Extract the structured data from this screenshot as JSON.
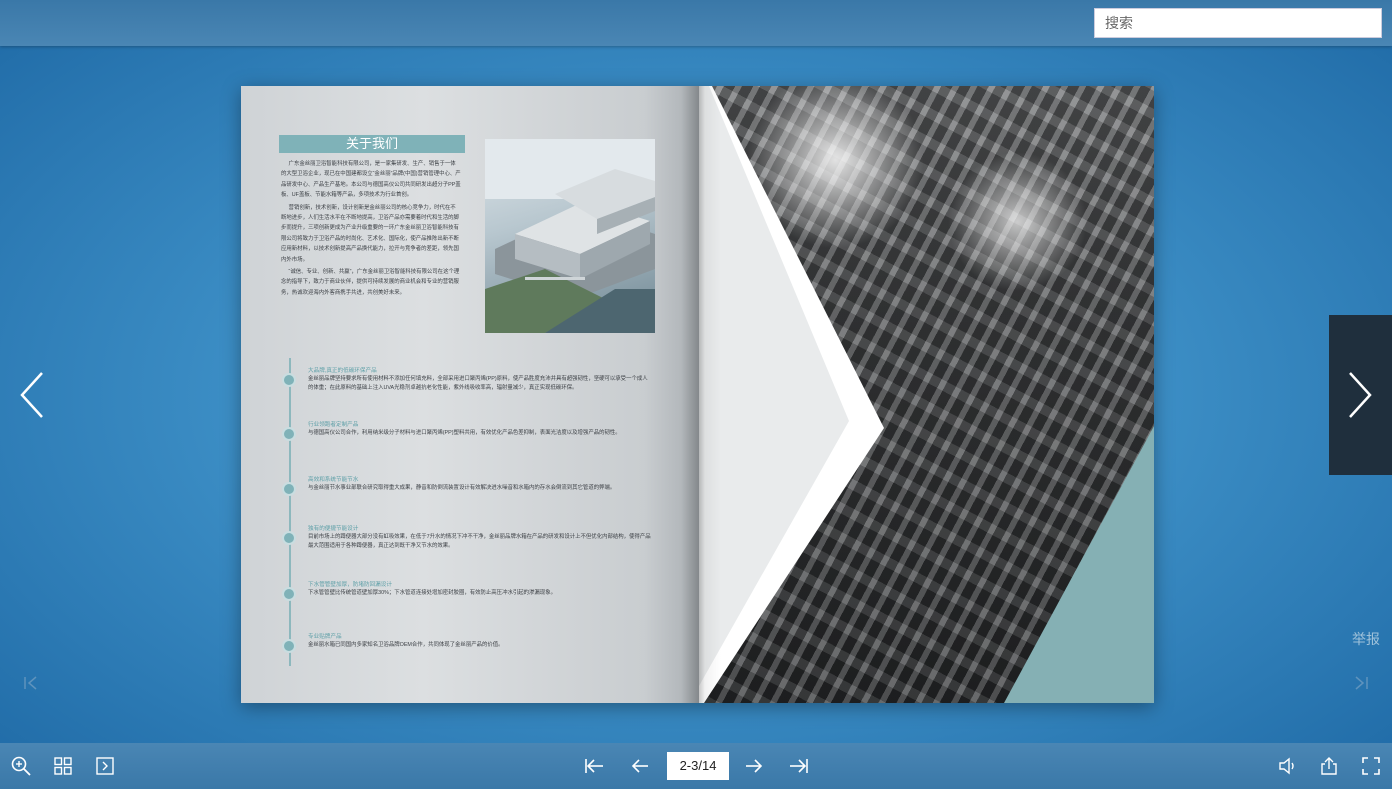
{
  "search": {
    "placeholder": "搜索"
  },
  "book": {
    "left_page": {
      "about": {
        "title": "关于我们",
        "paragraphs": [
          "广东金丝丽卫浴智能科技有限公司，是一家集研发、生产、销售于一体的大型卫浴企业，现已在中国建都设立“金丝丽”品牌(中国)营销管理中心、产品研发中心、产品生产基地。本公司与德国高仪公司共同研发出超分子PP盖板、UF盖板、节能水箱等产品，多项技术为行业首创。",
          "营销创新，技术创新，设计创新是金丝丽公司的核心竞争力，时代在不断地进步，人们生活水平在不断地提高，卫浴产品亦需要着时代和生活的脚步而提升，三项创新更成为产业升级重要的一环广东金丝丽卫浴智能科技有限公司将致力于卫浴产品的时尚化、艺术化、国际化，使产品推陈出新不断应用新材料，以技术创新提高产品换代能力，拉开与竞争者的差距，领先国内外市场。",
          "“诚信、专业、创新、共赢”，广东金丝丽卫浴智能科技有限公司在这个理念的指导下，致力于商业伙伴，提供可持续发展的商业机会和专业的营销服务，热诚欢迎海内外客商携手共进，共创美好未来。"
        ]
      },
      "timeline": [
        {
          "heading": "大品牌,真正的低碳环保产品",
          "text": "金丝丽品牌坚持要求所有使用材料不添加任何填充料，全部采用进口聚丙烯(PP)原料，使产品胜度充沛并具有超强韧性，坚硬可以承受一个成人的体重；在此原料的基础上注入UVA光稳剂卓越抗老化性能，紫外线吸收率高，辐射量减少，真正实现低碳环保。"
        },
        {
          "heading": "行业领跑者定制产品",
          "text": "与德国高仪公司合作，利用纳米级分子材料与进口聚丙烯(PP)塑料共用，有效优化产品色差抑制，表面光洁度以及增强产品的韧性。"
        },
        {
          "heading": "高效和系统节能节水",
          "text": "与金丝丽节水事业部联合研究取得重大成果，静音和防倒流装置设计有效解决进水噪音和水箱内的存水会倒流到其它管道的弊端。"
        },
        {
          "heading": "独有的便捷节能设计",
          "text": "目前市场上的蹲便器大部分没有虹吸效果，在低于7升水的情况下冲不干净，金丝丽品牌水箱在产品的研发和设计上不但优化内部结构，使得产品最大范围适用于各种蹲便器，真正达到既干净又节水的效果。"
        },
        {
          "heading": "下水管管壁加厚，防堵防回漏设计",
          "text": "下水管管壁比传统管道壁加厚30%；下水管道连接处增加密封胶圈，有效防止高压冲水引起的渗漏现象。"
        },
        {
          "heading": "专业贴牌产品",
          "text": "金丝丽水箱已同国内多家知名卫浴品牌OEM合作，共同体现了金丝丽产品的价值。"
        }
      ]
    }
  },
  "navigation": {
    "report_label": "举报",
    "page_indicator": "2-3/14"
  },
  "colors": {
    "accent_teal": "#7fb2b8",
    "nav_panel": "#1f2f3d"
  },
  "icons": {
    "prev": "chevron-left-icon",
    "next": "chevron-right-icon",
    "zoom": "zoom-in-icon",
    "thumbnails": "grid-icon",
    "autoplay": "autoplay-icon",
    "first": "first-page-icon",
    "previous": "previous-page-icon",
    "forward": "next-page-icon",
    "last": "last-page-icon",
    "sound": "sound-icon",
    "share": "share-icon",
    "fullscreen": "fullscreen-icon"
  }
}
